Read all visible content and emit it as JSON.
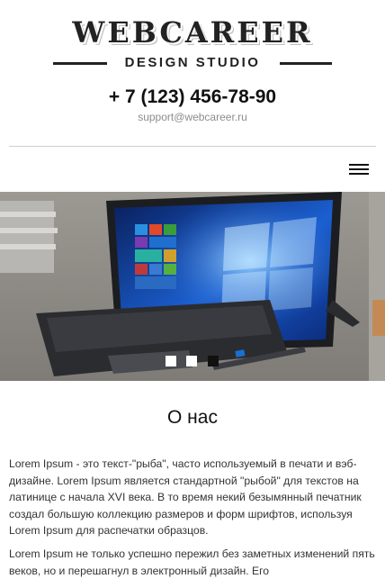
{
  "header": {
    "logo_main": "WEBCAREER",
    "logo_sub": "DESIGN STUDIO",
    "phone": "+ 7 (123) 456-78-90",
    "email": "support@webcareer.ru"
  },
  "nav": {
    "menu_icon": "hamburger-menu-icon"
  },
  "slider": {
    "image_description": "laptop-tablet-with-keyboard-and-pen",
    "dots": [
      {
        "active": false
      },
      {
        "active": false
      },
      {
        "active": true
      }
    ]
  },
  "about": {
    "title": "О нас",
    "paragraphs": [
      "Lorem Ipsum - это текст-\"рыба\", часто используемый в печати и вэб-дизайне. Lorem Ipsum является стандартной \"рыбой\" для текстов на латинице с начала XVI века. В то время некий безымянный печатник создал большую коллекцию размеров и форм шрифтов, используя Lorem Ipsum для распечатки образцов.",
      "Lorem Ipsum не только успешно пережил без заметных изменений пять веков, но и перешагнул в электронный дизайн. Его"
    ]
  },
  "colors": {
    "text_dark": "#111111",
    "text_body": "#333333",
    "email_gray": "#8c8c8c",
    "divider": "#cfcfcf",
    "active_dot": "#111111"
  }
}
